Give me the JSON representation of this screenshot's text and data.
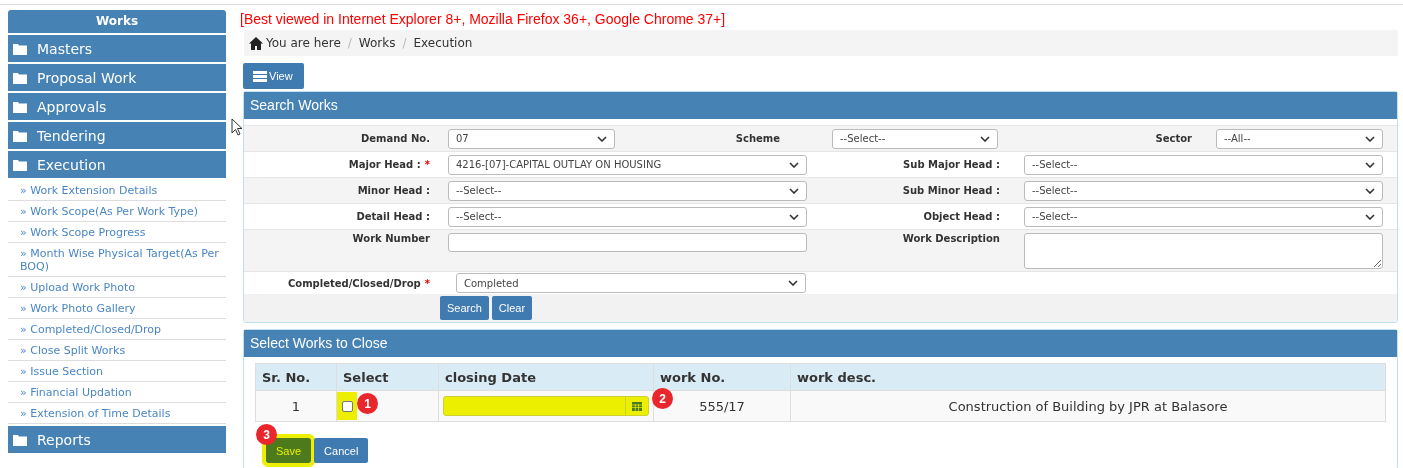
{
  "sidebar": {
    "title": "Works",
    "sections": [
      {
        "label": "Masters"
      },
      {
        "label": "Proposal Work"
      },
      {
        "label": "Approvals"
      },
      {
        "label": "Tendering"
      },
      {
        "label": "Execution",
        "items": [
          {
            "label": "» Work Extension Details"
          },
          {
            "label": "» Work Scope(As Per Work Type)"
          },
          {
            "label": "» Work Scope Progress"
          },
          {
            "label": "» Month Wise Physical Target(As Per BOQ)"
          },
          {
            "label": "» Upload Work Photo"
          },
          {
            "label": "» Work Photo Gallery"
          },
          {
            "label": "» Completed/Closed/Drop"
          },
          {
            "label": "» Close Split Works"
          },
          {
            "label": "» Issue Section"
          },
          {
            "label": "» Financial Updation"
          },
          {
            "label": "» Extension of Time Details"
          }
        ]
      },
      {
        "label": "Reports"
      }
    ]
  },
  "notice": "[Best viewed in Internet Explorer 8+, Mozilla Firefox 36+, Google Chrome 37+]",
  "breadcrumb": [
    {
      "label": "You are here"
    },
    {
      "separator": "/",
      "label": "Works"
    },
    {
      "separator": "/",
      "label": "Execution"
    }
  ],
  "view_button": "View",
  "search_panel": {
    "title": "Search Works",
    "rows": [
      {
        "fields": [
          {
            "label": "Demand No.",
            "kind": "select",
            "value": "07"
          },
          {
            "label": "Scheme",
            "kind": "select",
            "value": "--Select--"
          },
          {
            "label": "Sector",
            "kind": "select",
            "value": "--All--"
          }
        ]
      },
      {
        "fields": [
          {
            "label": "Major Head :",
            "kind": "select",
            "value": "4216-[07]-CAPITAL OUTLAY ON HOUSING",
            "required_mark": "*"
          },
          {
            "label": "Sub Major Head :",
            "kind": "select",
            "value": "--Select--"
          }
        ]
      },
      {
        "fields": [
          {
            "label": "Minor Head :",
            "kind": "select",
            "value": "--Select--"
          },
          {
            "label": "Sub Minor Head :",
            "kind": "select",
            "value": "--Select--"
          }
        ]
      },
      {
        "fields": [
          {
            "label": "Detail Head :",
            "kind": "select",
            "value": "--Select--"
          },
          {
            "label": "Object Head :",
            "kind": "select",
            "value": "--Select--"
          }
        ]
      },
      {
        "fields": [
          {
            "label": "Work Number",
            "kind": "text"
          },
          {
            "label": "Work Description",
            "kind": "textarea"
          }
        ]
      },
      {
        "fields": [
          {
            "label": "Completed/Closed/Drop",
            "kind": "select",
            "value": "Completed",
            "required_mark": "*"
          }
        ]
      }
    ],
    "buttons": [
      "Search",
      "Clear"
    ]
  },
  "close_panel": {
    "title": "Select Works to Close",
    "table": {
      "columns": [
        "Sr. No.",
        "Select",
        "closing Date",
        "work No.",
        "work desc."
      ],
      "rows": [
        {
          "sr_no": "1",
          "checked": false,
          "select_highlighted": true,
          "select_callout": "1",
          "date_highlighted": true,
          "date_callout": "2",
          "work_no": "555/17",
          "work_desc": "Construction of Building by JPR at Balasore"
        }
      ]
    },
    "buttons": [
      {
        "label": "Save",
        "kind": "save",
        "highlighted": true,
        "callout": "3"
      },
      {
        "label": "Cancel",
        "kind": "cancel",
        "highlighted": false
      }
    ]
  }
}
